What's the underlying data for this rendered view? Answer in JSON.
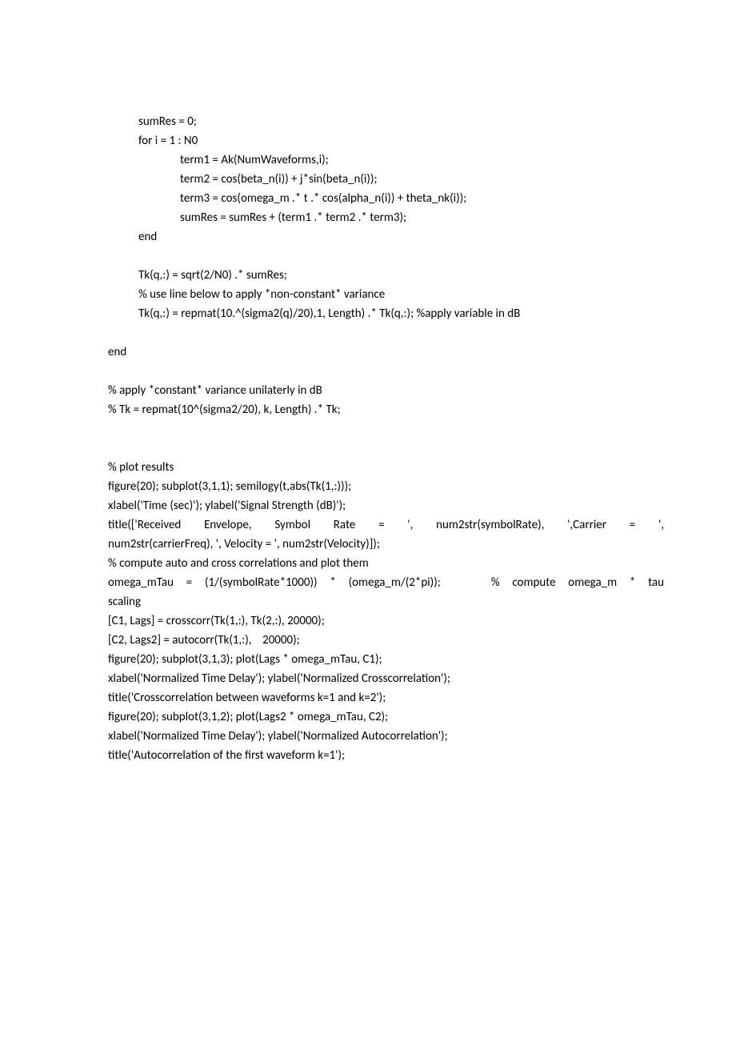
{
  "lines": [
    {
      "indent": 1,
      "text": "sumRes = 0;"
    },
    {
      "indent": 1,
      "text": "for i = 1 : N0"
    },
    {
      "indent": 2,
      "text": "term1 = Ak(NumWaveforms,i);"
    },
    {
      "indent": 2,
      "text": "term2 = cos(beta_n(i)) + j*sin(beta_n(i));"
    },
    {
      "indent": 2,
      "text": "term3 = cos(omega_m .* t .* cos(alpha_n(i)) + theta_nk(i));"
    },
    {
      "indent": 2,
      "text": "sumRes = sumRes + (term1 .* term2 .* term3);"
    },
    {
      "indent": 1,
      "text": "end"
    },
    {
      "blank": true
    },
    {
      "indent": 1,
      "text": "Tk(q,:) = sqrt(2/N0) .* sumRes;"
    },
    {
      "indent": 1,
      "text": "% use line below to apply *non-constant* variance"
    },
    {
      "indent": 1,
      "text": "Tk(q,:) = repmat(10.^(sigma2(q)/20),1, Length) .* Tk(q,:); %apply variable in dB"
    },
    {
      "blank": true
    },
    {
      "indent": 0,
      "text": "end"
    },
    {
      "blank": true
    },
    {
      "indent": 0,
      "text": "% apply *constant* variance unilaterly in dB"
    },
    {
      "indent": 0,
      "text": "% Tk = repmat(10^(sigma2/20), k, Length) .* Tk;"
    },
    {
      "blank": true
    },
    {
      "blank": true
    },
    {
      "indent": 0,
      "text": "% plot results"
    },
    {
      "indent": 0,
      "text": "figure(20); subplot(3,1,1); semilogy(t,abs(Tk(1,:)));"
    },
    {
      "indent": 0,
      "text": "xlabel('Time (sec)'); ylabel('Signal Strength (dB)');"
    },
    {
      "indent": 0,
      "justify": true,
      "text": "title(['Received Envelope, Symbol Rate = ', num2str(symbolRate), ',Carrier = ',"
    },
    {
      "indent": 0,
      "text": "num2str(carrierFreq), ', Velocity = ', num2str(Velocity)]);"
    },
    {
      "indent": 0,
      "text": "% compute auto and cross correlations and plot them"
    },
    {
      "indent": 0,
      "justify": true,
      "text": "omega_mTau = (1/(symbolRate*1000)) * (omega_m/(2*pi));    % compute omega_m * tau"
    },
    {
      "indent": 0,
      "text": "scaling"
    },
    {
      "indent": 0,
      "text": "[C1, Lags] = crosscorr(Tk(1,:), Tk(2,:), 20000);"
    },
    {
      "indent": 0,
      "text": "[C2, Lags2] = autocorr(Tk(1,:),    20000);"
    },
    {
      "indent": 0,
      "text": "figure(20); subplot(3,1,3); plot(Lags * omega_mTau, C1);"
    },
    {
      "indent": 0,
      "text": "xlabel('Normalized Time Delay'); ylabel('Normalized Crosscorrelation');"
    },
    {
      "indent": 0,
      "text": "title('Crosscorrelation between waveforms k=1 and k=2');"
    },
    {
      "indent": 0,
      "text": "figure(20); subplot(3,1,2); plot(Lags2 * omega_mTau, C2);"
    },
    {
      "indent": 0,
      "text": "xlabel('Normalized Time Delay'); ylabel('Normalized Autocorrelation');"
    },
    {
      "indent": 0,
      "text": "title('Autocorrelation of the first waveform k=1');"
    }
  ]
}
